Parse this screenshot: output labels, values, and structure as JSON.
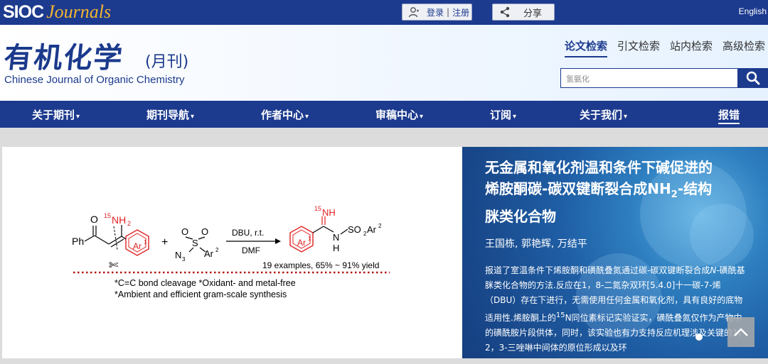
{
  "topbar": {
    "brand_main": "SIOC",
    "brand_sub": "Journals",
    "login_label": "登录",
    "register_label": "注册",
    "share_label": "分享",
    "language_link": "English"
  },
  "header": {
    "logo_cn": "有机化学",
    "logo_monthly": "(月刊)",
    "logo_en": "Chinese Journal of Organic Chemistry",
    "search_tabs": [
      {
        "label": "论文检索",
        "active": true
      },
      {
        "label": "引文检索",
        "active": false
      },
      {
        "label": "站内检索",
        "active": false
      },
      {
        "label": "高级检索",
        "active": false
      }
    ],
    "search_value": "氢氨化",
    "search_icon": "search-icon"
  },
  "nav": {
    "items": [
      {
        "label": "关于期刊"
      },
      {
        "label": "期刊导航"
      },
      {
        "label": "作者中心"
      },
      {
        "label": "审稿中心"
      },
      {
        "label": "订阅"
      },
      {
        "label": "关于我们"
      }
    ],
    "report_label": "报错"
  },
  "banner": {
    "graphic": {
      "ketone_o": "O",
      "ph": "Ph",
      "nh2_iso": "15",
      "nh2": "NH",
      "nh2_sub": "2",
      "ar1": "Ar",
      "ar1_sup": "1",
      "plus": "+",
      "n3": "N",
      "n3_sub": "3",
      "s": "S",
      "o": "O",
      "ar2": "Ar",
      "ar2_sup": "2",
      "reagent_top": "DBU, r.t.",
      "reagent_bottom": "DMF",
      "prod_iso": "15",
      "prod_nh": "NH",
      "prod_n": "N",
      "prod_h": "H",
      "prod_so2": "SO",
      "prod_so2_sub": "2",
      "prod_ar2": "Ar",
      "prod_ar2_sup": "2",
      "prod_ar1": "Ar",
      "prod_ar1_sup": "1",
      "yield_text": "19 examples, 65% ~ 91% yield",
      "features": [
        "*C=C bond cleavage  *Oxidant- and metal-free",
        "*Ambient and efficient gram-scale synthesis"
      ]
    },
    "article": {
      "title_line1": "无金属和氧化剂温和条件下碱促进的",
      "title_line2a": "烯胺酮碳-碳双键断裂合成NH",
      "title_line2_sub": "2",
      "title_line2b": "-结构",
      "title_line3": "脒类化合物",
      "authors": "王国栋, 郭艳辉, 万结平",
      "abstract_a": "报道了室温条件下烯胺酮和磺酰叠氮通过碳-碳双键断裂合成",
      "abstract_italic": "N",
      "abstract_b": "-磺酰基脒类化合物的方法.反应在1，8-二氮杂双环[5.4.0]十一碳-7-烯（DBU）存在下进行，无需使用任何金属和氧化剂，具有良好的底物适用性.烯胺酮上的",
      "abstract_sup": "15",
      "abstract_c": "N同位素标记实验证实，磺酰叠氮仅作为产物中的磺酰胺片段供体，同时，该实验也有力支持反应机理涉及关键的1，2，3-三唑啉中间体的原位形成以及环"
    }
  },
  "colors": {
    "brand_blue": "#1c3a8e",
    "gold": "#f2b630",
    "red_ring": "#e02020"
  }
}
